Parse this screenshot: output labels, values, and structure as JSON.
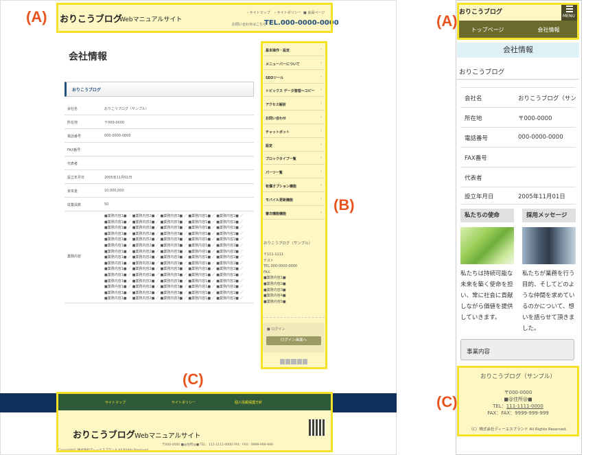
{
  "callouts": {
    "a1": "(A)",
    "b": "(B)",
    "c1": "(C)",
    "a2": "(A)",
    "c2": "(C)"
  },
  "desktop": {
    "header": {
      "logo_main": "おりこうブログ",
      "logo_sub": "Webマニュアルサイト",
      "links": [
        "› サイトマップ",
        "› サイトポリシー",
        "■ 会員ページ"
      ],
      "contact_label": "お問い合わせはこちら",
      "tel": "TEL.000-0000-0000"
    },
    "page_title": "会社情報",
    "section_title": "おりこうブログ",
    "rows": [
      {
        "k": "会社名",
        "v": "おりこうブログ（サンプル）"
      },
      {
        "k": "所在地",
        "v": "〒000-0000"
      },
      {
        "k": "電話番号",
        "v": "000-0000-0000"
      },
      {
        "k": "FAX番号",
        "v": ""
      },
      {
        "k": "代表者",
        "v": ""
      },
      {
        "k": "設立年月日",
        "v": "2005年11月01日"
      },
      {
        "k": "資本金",
        "v": "10,000,000"
      },
      {
        "k": "従業員数",
        "v": "50"
      }
    ],
    "business_label": "業務内容",
    "business_line": "■業務内容1■ ／ ■業務内容2■ ／ ■業務内容3■ ／ ■業務内容1■ ／ ■業務内容2■ ／",
    "sidebar": {
      "items": [
        "基本操作・設定",
        "メニューバーについて",
        "SEOツール",
        "トピックス データ管理〜コピー",
        "アクセス解析",
        "お問い合わせ",
        "チャットボット",
        "設定",
        "ブロックタイプ一覧",
        "パーツ一覧",
        "有償オプション機能",
        "モバイル更新機能",
        "審次機能機能"
      ],
      "company": "おりこうブログ（サンプル）",
      "lines": [
        "〒111-1111",
        "テスト",
        "TEL.000-0000-0000",
        "FAX.",
        "■業務内容1■",
        "■業務内容2■",
        "■業務内容3■",
        "■業務内容4■",
        "■業務内容5■"
      ],
      "login_label": "■ ログイン",
      "login_button": "ログイン画面へ"
    },
    "footer": {
      "nav": [
        "サイトマップ",
        "サイトポリシー",
        "個人情報保護方針"
      ],
      "logo_main": "おりこうブログ",
      "logo_sub": "Webマニュアルサイト",
      "copyright": "Copyright© 株式会社ディーエスブランド All Rights Reserved.",
      "address": "〒000-0000 ■@住所@■ TEL：111-1111-0000 FAX：FAX：9999-999-999"
    }
  },
  "mobile": {
    "header_logo": "おりこうブログ",
    "menu_label": "MENU",
    "nav": [
      "トップページ",
      "会社情報"
    ],
    "title": "会社情報",
    "subtitle": "おりこうブログ",
    "rows": [
      {
        "k": "会社名",
        "v": "おりこうブログ（サンプル）"
      },
      {
        "k": "所在地",
        "v": "〒000-0000"
      },
      {
        "k": "電話番号",
        "v": "000-0000-0000"
      },
      {
        "k": "FAX番号",
        "v": ""
      },
      {
        "k": "代表者",
        "v": ""
      },
      {
        "k": "設立年月日",
        "v": "2005年11月01日"
      }
    ],
    "cards": [
      {
        "title": "私たちの使命",
        "lines": [
          "私たちは持続可能な",
          "未来を築く使命を担",
          "い、常に社会に貢献",
          "しながら価値を提供",
          "していきます。"
        ]
      },
      {
        "title": "採用メッセージ",
        "lines": [
          "私たちが業務を行う",
          "目的、そしてどのよ",
          "うな仲間を求めてい",
          "るのかについて、想",
          "いを語らせて頂きま",
          "した。"
        ]
      }
    ],
    "button": "事業内容",
    "footer": {
      "company": "おりこうブログ（サンプル）",
      "zip": "〒000-0000",
      "addr": "■@住所@■",
      "tel_label": "TEL：",
      "tel": "111-1111-0000",
      "fax": "FAX：FAX：9999-999-999",
      "copyright": "（C）株式会社ディーエスブランド All Rights Reserved."
    }
  }
}
